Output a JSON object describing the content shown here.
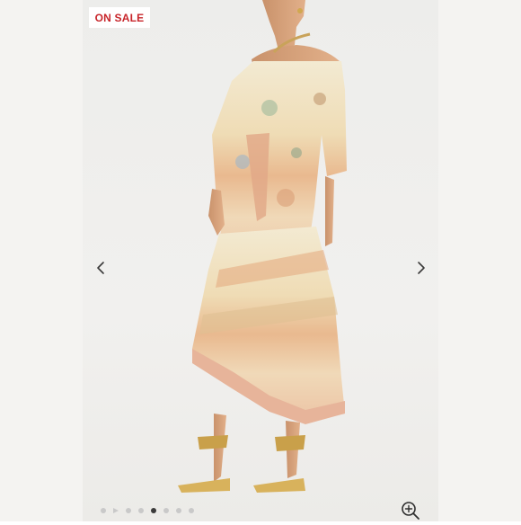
{
  "badge": {
    "label": "ON SALE",
    "color": "#c8262b"
  },
  "gallery": {
    "slide_count": 8,
    "active_index": 4,
    "prev_icon": "chevron-left-icon",
    "next_icon": "chevron-right-icon",
    "zoom_icon": "zoom-in-icon"
  }
}
